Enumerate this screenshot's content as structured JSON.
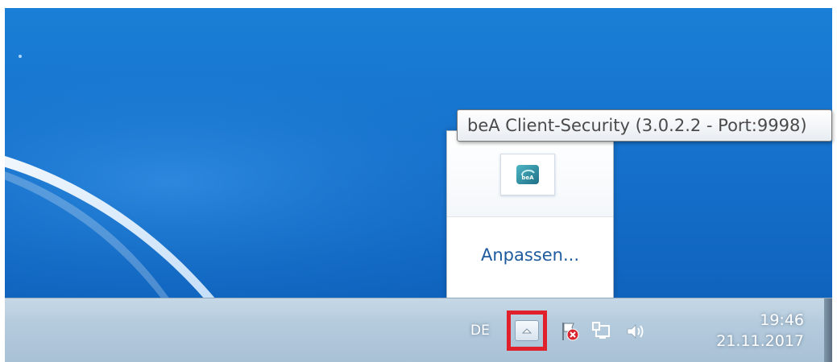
{
  "tooltip": {
    "text": "beA Client-Security (3.0.2.2 - Port:9998)"
  },
  "popup": {
    "customize_label": "Anpassen...",
    "icon": "bea-client-security-icon"
  },
  "taskbar": {
    "language": "DE",
    "expand_icon": "chevron-up-icon",
    "tray_icons": [
      "action-center-flag-error-icon",
      "network-icon",
      "volume-icon"
    ],
    "time": "19:46",
    "date": "21.11.2017"
  },
  "colors": {
    "highlight": "#e0202a",
    "link": "#1e5a9e",
    "desktop": "#1570cb"
  }
}
